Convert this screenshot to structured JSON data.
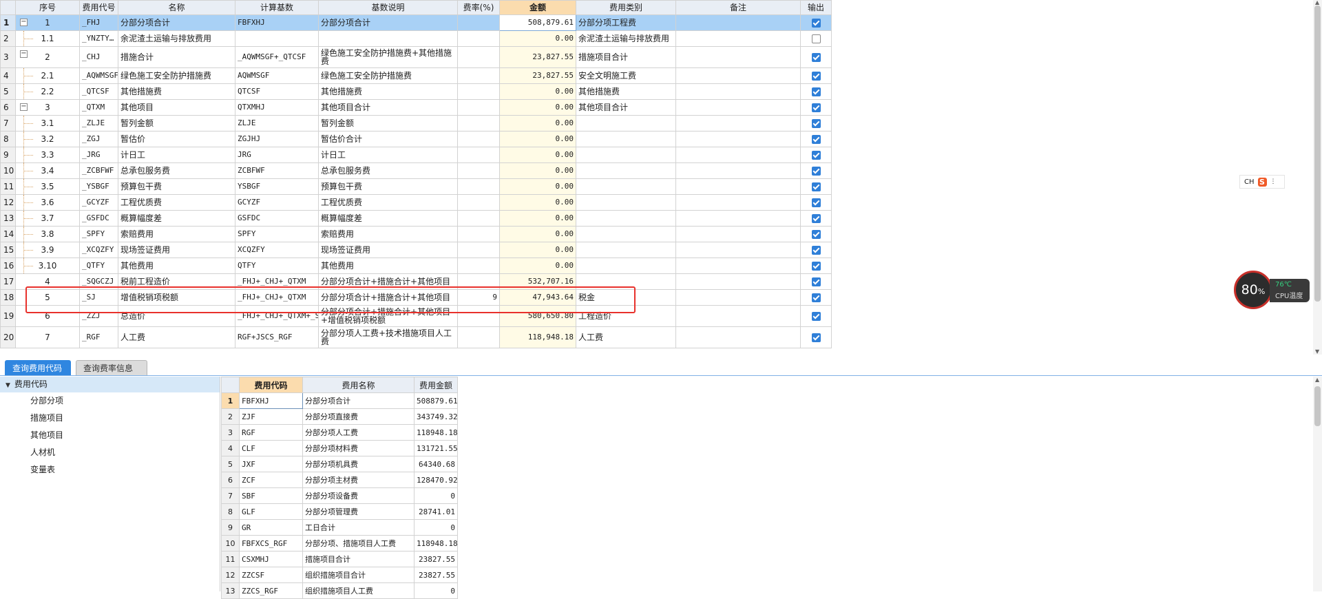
{
  "top_grid": {
    "headers": {
      "seq": "序号",
      "code": "费用代号",
      "name": "名称",
      "base": "计算基数",
      "desc": "基数说明",
      "rate": "费率(%)",
      "amount": "金额",
      "category": "费用类别",
      "note": "备注",
      "output": "输出"
    },
    "rows": [
      {
        "rn": "1",
        "seq": "1",
        "code": "_FHJ",
        "name": "分部分项合计",
        "base": "FBFXHJ",
        "desc": "分部分项合计",
        "rate": "",
        "amount": "508,879.61",
        "category": "分部分项工程费",
        "note": "",
        "checked": true,
        "level": 0,
        "toggle": "−",
        "selected": true,
        "tall": false
      },
      {
        "rn": "2",
        "seq": "1.1",
        "code": "_YNZTY…",
        "name": "余泥渣土运输与排放费用",
        "base": "",
        "desc": "",
        "rate": "",
        "amount": "0.00",
        "category": "余泥渣土运输与排放费用",
        "note": "",
        "checked": false,
        "level": 1,
        "toggle": "",
        "selected": false,
        "tall": false
      },
      {
        "rn": "3",
        "seq": "2",
        "code": "_CHJ",
        "name": "措施合计",
        "base": "_AQWMSGF+_QTCSF",
        "desc": "绿色施工安全防护措施费+其他措施费",
        "rate": "",
        "amount": "23,827.55",
        "category": "措施项目合计",
        "note": "",
        "checked": true,
        "level": 0,
        "toggle": "−",
        "selected": false,
        "tall": true
      },
      {
        "rn": "4",
        "seq": "2.1",
        "code": "_AQWMSGF",
        "name": "绿色施工安全防护措施费",
        "base": "AQWMSGF",
        "desc": "绿色施工安全防护措施费",
        "rate": "",
        "amount": "23,827.55",
        "category": "安全文明施工费",
        "note": "",
        "checked": true,
        "level": 1,
        "toggle": "",
        "selected": false,
        "tall": false
      },
      {
        "rn": "5",
        "seq": "2.2",
        "code": "_QTCSF",
        "name": "其他措施费",
        "base": "QTCSF",
        "desc": "其他措施费",
        "rate": "",
        "amount": "0.00",
        "category": "其他措施费",
        "note": "",
        "checked": true,
        "level": 1,
        "toggle": "",
        "selected": false,
        "tall": false
      },
      {
        "rn": "6",
        "seq": "3",
        "code": "_QTXM",
        "name": "其他项目",
        "base": "QTXMHJ",
        "desc": "其他项目合计",
        "rate": "",
        "amount": "0.00",
        "category": "其他项目合计",
        "note": "",
        "checked": true,
        "level": 0,
        "toggle": "−",
        "selected": false,
        "tall": false
      },
      {
        "rn": "7",
        "seq": "3.1",
        "code": "_ZLJE",
        "name": "暂列金额",
        "base": "ZLJE",
        "desc": "暂列金额",
        "rate": "",
        "amount": "0.00",
        "category": "",
        "note": "",
        "checked": true,
        "level": 1,
        "toggle": "",
        "selected": false,
        "tall": false
      },
      {
        "rn": "8",
        "seq": "3.2",
        "code": "_ZGJ",
        "name": "暂估价",
        "base": "ZGJHJ",
        "desc": "暂估价合计",
        "rate": "",
        "amount": "0.00",
        "category": "",
        "note": "",
        "checked": true,
        "level": 1,
        "toggle": "",
        "selected": false,
        "tall": false
      },
      {
        "rn": "9",
        "seq": "3.3",
        "code": "_JRG",
        "name": "计日工",
        "base": "JRG",
        "desc": "计日工",
        "rate": "",
        "amount": "0.00",
        "category": "",
        "note": "",
        "checked": true,
        "level": 1,
        "toggle": "",
        "selected": false,
        "tall": false
      },
      {
        "rn": "10",
        "seq": "3.4",
        "code": "_ZCBFWF",
        "name": "总承包服务费",
        "base": "ZCBFWF",
        "desc": "总承包服务费",
        "rate": "",
        "amount": "0.00",
        "category": "",
        "note": "",
        "checked": true,
        "level": 1,
        "toggle": "",
        "selected": false,
        "tall": false
      },
      {
        "rn": "11",
        "seq": "3.5",
        "code": "_YSBGF",
        "name": "预算包干费",
        "base": "YSBGF",
        "desc": "预算包干费",
        "rate": "",
        "amount": "0.00",
        "category": "",
        "note": "",
        "checked": true,
        "level": 1,
        "toggle": "",
        "selected": false,
        "tall": false
      },
      {
        "rn": "12",
        "seq": "3.6",
        "code": "_GCYZF",
        "name": "工程优质费",
        "base": "GCYZF",
        "desc": "工程优质费",
        "rate": "",
        "amount": "0.00",
        "category": "",
        "note": "",
        "checked": true,
        "level": 1,
        "toggle": "",
        "selected": false,
        "tall": false
      },
      {
        "rn": "13",
        "seq": "3.7",
        "code": "_GSFDC",
        "name": "概算幅度差",
        "base": "GSFDC",
        "desc": "概算幅度差",
        "rate": "",
        "amount": "0.00",
        "category": "",
        "note": "",
        "checked": true,
        "level": 1,
        "toggle": "",
        "selected": false,
        "tall": false
      },
      {
        "rn": "14",
        "seq": "3.8",
        "code": "_SPFY",
        "name": "索赔费用",
        "base": "SPFY",
        "desc": "索赔费用",
        "rate": "",
        "amount": "0.00",
        "category": "",
        "note": "",
        "checked": true,
        "level": 1,
        "toggle": "",
        "selected": false,
        "tall": false
      },
      {
        "rn": "15",
        "seq": "3.9",
        "code": "_XCQZFY",
        "name": "现场签证费用",
        "base": "XCQZFY",
        "desc": "现场签证费用",
        "rate": "",
        "amount": "0.00",
        "category": "",
        "note": "",
        "checked": true,
        "level": 1,
        "toggle": "",
        "selected": false,
        "tall": false
      },
      {
        "rn": "16",
        "seq": "3.10",
        "code": "_QTFY",
        "name": "其他费用",
        "base": "QTFY",
        "desc": "其他费用",
        "rate": "",
        "amount": "0.00",
        "category": "",
        "note": "",
        "checked": true,
        "level": 1,
        "toggle": "",
        "selected": false,
        "tall": false
      },
      {
        "rn": "17",
        "seq": "4",
        "code": "_SQGCZJ",
        "name": "税前工程造价",
        "base": "_FHJ+_CHJ+_QTXM",
        "desc": "分部分项合计+措施合计+其他项目",
        "rate": "",
        "amount": "532,707.16",
        "category": "",
        "note": "",
        "checked": true,
        "level": 0,
        "toggle": "",
        "selected": false,
        "tall": false
      },
      {
        "rn": "18",
        "seq": "5",
        "code": "_SJ",
        "name": "增值税销项税额",
        "base": "_FHJ+_CHJ+_QTXM",
        "desc": "分部分项合计+措施合计+其他项目",
        "rate": "9",
        "amount": "47,943.64",
        "category": "税金",
        "note": "",
        "checked": true,
        "level": 0,
        "toggle": "",
        "selected": false,
        "tall": false
      },
      {
        "rn": "19",
        "seq": "6",
        "code": "_ZZJ",
        "name": "总造价",
        "base": "_FHJ+_CHJ+_QTXM+_SJ",
        "desc": "分部分项合计+措施合计+其他项目+增值税销项税额",
        "rate": "",
        "amount": "580,650.80",
        "category": "工程造价",
        "note": "",
        "checked": true,
        "level": 0,
        "toggle": "",
        "selected": false,
        "tall": true
      },
      {
        "rn": "20",
        "seq": "7",
        "code": "_RGF",
        "name": "人工费",
        "base": "RGF+JSCS_RGF",
        "desc": "分部分项人工费+技术措施项目人工费",
        "rate": "",
        "amount": "118,948.18",
        "category": "人工费",
        "note": "",
        "checked": true,
        "level": 0,
        "toggle": "",
        "selected": false,
        "tall": true
      }
    ]
  },
  "ime": {
    "lang": "CH",
    "icon": "S",
    "icon_name": "sogou-ime-icon"
  },
  "cpu_widget": {
    "percent": "80",
    "percent_unit": "%",
    "temperature": "76℃",
    "label": "CPU温度"
  },
  "tabs": [
    {
      "label": "查询费用代码",
      "active": true
    },
    {
      "label": "查询费率信息",
      "active": false
    }
  ],
  "tree": {
    "root": "费用代码",
    "items": [
      "分部分项",
      "措施项目",
      "其他项目",
      "人材机",
      "变量表"
    ]
  },
  "bottom_grid": {
    "headers": {
      "code": "费用代码",
      "name": "费用名称",
      "amount": "费用金额"
    },
    "rows": [
      {
        "rn": "1",
        "code": "FBFXHJ",
        "name": "分部分项合计",
        "amount": "508879.61",
        "selected": true
      },
      {
        "rn": "2",
        "code": "ZJF",
        "name": "分部分项直接费",
        "amount": "343749.32",
        "selected": false
      },
      {
        "rn": "3",
        "code": "RGF",
        "name": "分部分项人工费",
        "amount": "118948.18",
        "selected": false
      },
      {
        "rn": "4",
        "code": "CLF",
        "name": "分部分项材料费",
        "amount": "131721.55",
        "selected": false
      },
      {
        "rn": "5",
        "code": "JXF",
        "name": "分部分项机具费",
        "amount": "64340.68",
        "selected": false
      },
      {
        "rn": "6",
        "code": "ZCF",
        "name": "分部分项主材费",
        "amount": "128470.92",
        "selected": false
      },
      {
        "rn": "7",
        "code": "SBF",
        "name": "分部分项设备费",
        "amount": "0",
        "selected": false
      },
      {
        "rn": "8",
        "code": "GLF",
        "name": "分部分项管理费",
        "amount": "28741.01",
        "selected": false
      },
      {
        "rn": "9",
        "code": "GR",
        "name": "工日合计",
        "amount": "0",
        "selected": false
      },
      {
        "rn": "10",
        "code": "FBFXCS_RGF",
        "name": "分部分项、措施项目人工费",
        "amount": "118948.18",
        "selected": false
      },
      {
        "rn": "11",
        "code": "CSXMHJ",
        "name": "措施项目合计",
        "amount": "23827.55",
        "selected": false
      },
      {
        "rn": "12",
        "code": "ZZCSF",
        "name": "组织措施项目合计",
        "amount": "23827.55",
        "selected": false
      },
      {
        "rn": "13",
        "code": "ZZCS_RGF",
        "name": "组织措施项目人工费",
        "amount": "0",
        "selected": false
      }
    ]
  },
  "colors": {
    "accent": "#2f86e0",
    "highlight": "#e8302b",
    "amount_header": "#fbdcae",
    "selected_row": "#a9d1f6"
  }
}
